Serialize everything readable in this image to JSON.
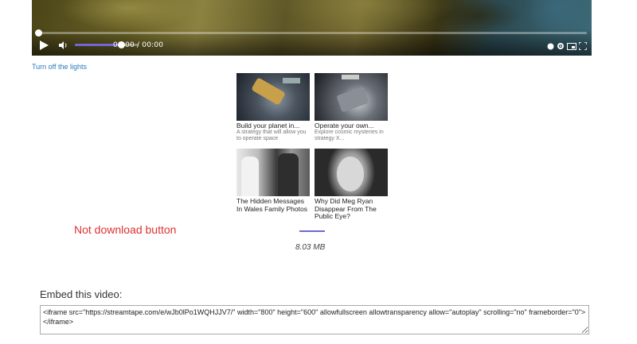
{
  "player": {
    "time": "00:00 / 00:00",
    "volume_level": 0.72,
    "icons": [
      "play-icon",
      "volume-icon",
      "settings-icon",
      "pip-icon",
      "fullscreen-icon"
    ]
  },
  "lights_link": "Turn off the lights",
  "ads": [
    {
      "title": "Build your planet in...",
      "desc": "A strategy that will allow you to operate space"
    },
    {
      "title": "Operate your own...",
      "desc": "Explore cosmic mysteries in strategy X..."
    },
    {
      "title": "The Hidden Messages In Wales Family Photos",
      "desc": ""
    },
    {
      "title": "Why Did Meg Ryan Disappear From The Public Eye?",
      "desc": ""
    }
  ],
  "not_download": "Not download button",
  "file_size": "8.03 MB",
  "embed": {
    "label": "Embed this video:",
    "code": "<iframe src=\"https://streamtape.com/e/wJb0lPo1WQHJJV7/\" width=\"800\" height=\"600\" allowfullscreen allowtransparency allow=\"autoplay\" scrolling=\"no\" frameborder=\"0\"></iframe>"
  },
  "colors": {
    "accent": "#6f68d4",
    "link": "#2b7bbd",
    "warning": "#e03030"
  }
}
